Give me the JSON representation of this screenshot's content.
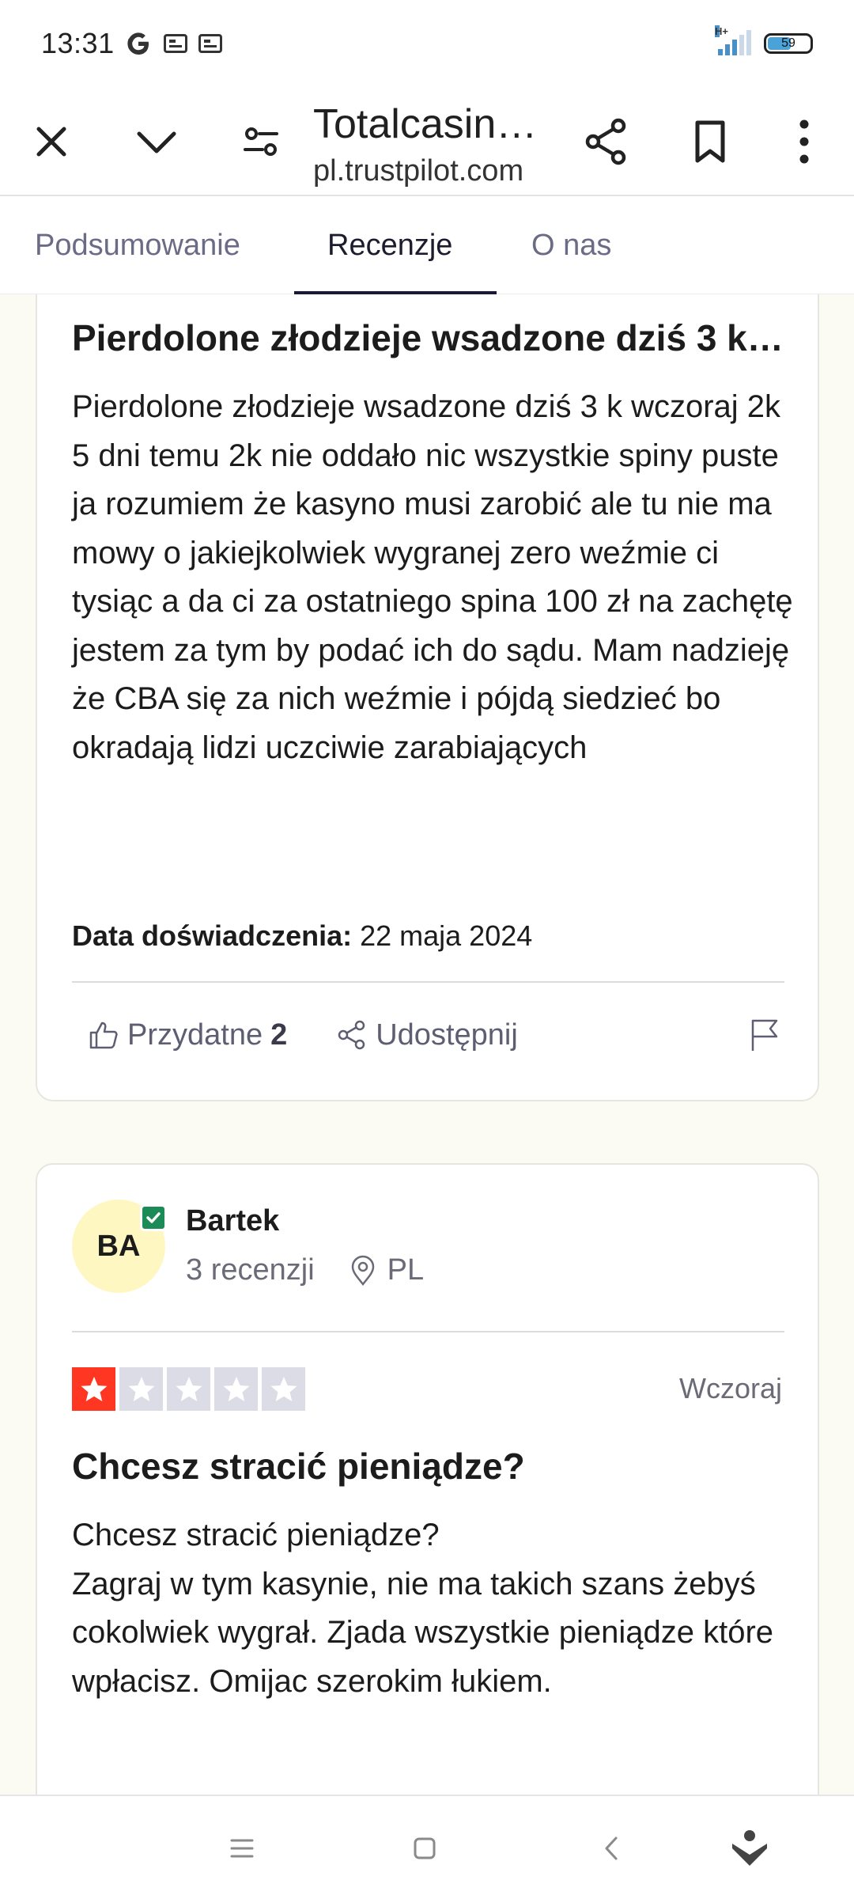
{
  "status_bar": {
    "time": "13:31",
    "network_label": "H+",
    "battery_level": "59"
  },
  "toolbar": {
    "page_title": "Totalcasin…",
    "host": "pl.trustpilot.com"
  },
  "tabs": [
    {
      "label": "Podsumowanie",
      "active": false
    },
    {
      "label": "Recenzje",
      "active": true
    },
    {
      "label": "O nas",
      "active": false
    }
  ],
  "review1": {
    "title": "Pierdolone złodzieje wsadzone dziś 3 k…",
    "body": "Pierdolone złodzieje wsadzone dziś 3 k wczoraj 2k 5 dni temu 2k nie oddało nic wszystkie spiny puste ja rozumiem że kasyno musi zarobić ale tu nie ma mowy o jakiejkolwiek wygranej zero weźmie ci tysiąc a da ci za ostatniego spina 100 zł na zachętę jestem za tym by podać ich do sądu. Mam nadzieję że CBA się za nich weźmie i pójdą siedzieć bo okradają lidzi uczciwie zarabiających",
    "experience_label": "Data doświadczenia:",
    "experience_date": "22 maja 2024",
    "useful_label": "Przydatne",
    "useful_count": "2",
    "share_label": "Udostępnij"
  },
  "review2": {
    "avatar_initials": "BA",
    "author": "Bartek",
    "review_count": "3 recenzji",
    "country": "PL",
    "rating": 1,
    "rating_max": 5,
    "date": "Wczoraj",
    "title": "Chcesz stracić pieniądze?",
    "body_line1": "Chcesz stracić pieniądze?",
    "body_line2": "Zagraj w tym kasynie, nie ma takich szans żebyś cokolwiek wygrał. Zjada wszystkie pieniądze które wpłacisz. Omijac szerokim łukiem."
  },
  "colors": {
    "star_on": "#ff3722",
    "star_off": "#dcdce6",
    "verified": "#1c8b57",
    "avatar_bg": "#fff7c2",
    "tab_underline": "#191935"
  }
}
